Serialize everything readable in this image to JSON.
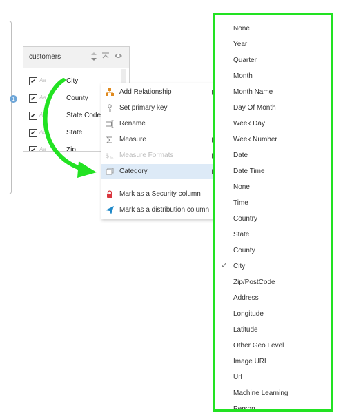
{
  "connector": {
    "badge": "1"
  },
  "table": {
    "title": "customers",
    "columns": [
      {
        "type": "Aa",
        "name": "City"
      },
      {
        "type": "Aa",
        "name": "County"
      },
      {
        "type": "Aa",
        "name": "State Code"
      },
      {
        "type": "Aa",
        "name": "State"
      },
      {
        "type": "Aa",
        "name": "Zip"
      }
    ]
  },
  "context_menu": {
    "items": [
      {
        "label": "Add Relationship",
        "icon": "relationship-icon",
        "submenu": true,
        "disabled": false
      },
      {
        "label": "Set primary key",
        "icon": "key-icon",
        "submenu": false,
        "disabled": false
      },
      {
        "label": "Rename",
        "icon": "rename-icon",
        "submenu": false,
        "disabled": false
      },
      {
        "label": "Measure",
        "icon": "sigma-icon",
        "submenu": true,
        "disabled": false
      },
      {
        "label": "Measure Formats",
        "icon": "format-icon",
        "submenu": true,
        "disabled": true
      },
      {
        "label": "Category",
        "icon": "category-icon",
        "submenu": true,
        "disabled": false,
        "active": true
      },
      {
        "label": "Mark as a Security column",
        "icon": "lock-icon",
        "submenu": false,
        "disabled": false
      },
      {
        "label": "Mark as a distribution column",
        "icon": "send-icon",
        "submenu": false,
        "disabled": false
      }
    ]
  },
  "category_menu": {
    "selected": "City",
    "items": [
      "None",
      "Year",
      "Quarter",
      "Month",
      "Month Name",
      "Day Of Month",
      "Week Day",
      "Week Number",
      "Date",
      "Date Time",
      "None",
      "Time",
      "Country",
      "State",
      "County",
      "City",
      "Zip/PostCode",
      "Address",
      "Longitude",
      "Latitude",
      "Other Geo Level",
      "Image URL",
      "Url",
      "Machine Learning",
      "Person"
    ]
  },
  "colors": {
    "highlight": "#22e222",
    "active_item": "#ddeaf7",
    "lock": "#d9363e",
    "send": "#1e88c8",
    "relationship": "#e08a1e"
  }
}
